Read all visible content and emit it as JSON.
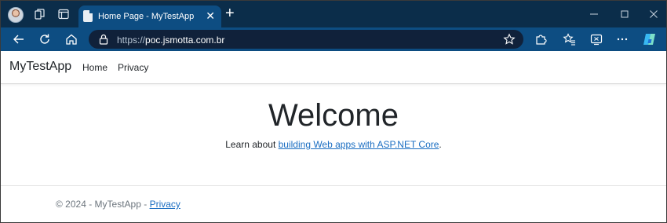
{
  "tab": {
    "title": "Home Page - MyTestApp",
    "close_label": "✕",
    "new_tab_label": "+"
  },
  "address": {
    "protocol": "https://",
    "host": "poc.jsmotta.com.br"
  },
  "site": {
    "brand": "MyTestApp",
    "nav": [
      {
        "label": "Home"
      },
      {
        "label": "Privacy"
      }
    ]
  },
  "main": {
    "heading": "Welcome",
    "lead_prefix": "Learn about ",
    "lead_link": "building Web apps with ASP.NET Core",
    "lead_suffix": "."
  },
  "footer": {
    "text": "© 2024 - MyTestApp - ",
    "link": "Privacy"
  },
  "colors": {
    "tabstrip": "#0b2d4a",
    "toolbar": "#0d4d82",
    "link": "#1b6ec2"
  },
  "icons": [
    "profile-avatar",
    "workspaces-icon",
    "tab-actions-icon",
    "page-favicon",
    "close-icon",
    "new-tab-icon",
    "minimize-icon",
    "maximize-icon",
    "window-close-icon",
    "back-icon",
    "refresh-icon",
    "home-icon",
    "lock-icon",
    "favorite-star-icon",
    "extensions-icon",
    "favorites-icon",
    "screenshot-icon",
    "more-menu-icon",
    "copilot-icon"
  ]
}
